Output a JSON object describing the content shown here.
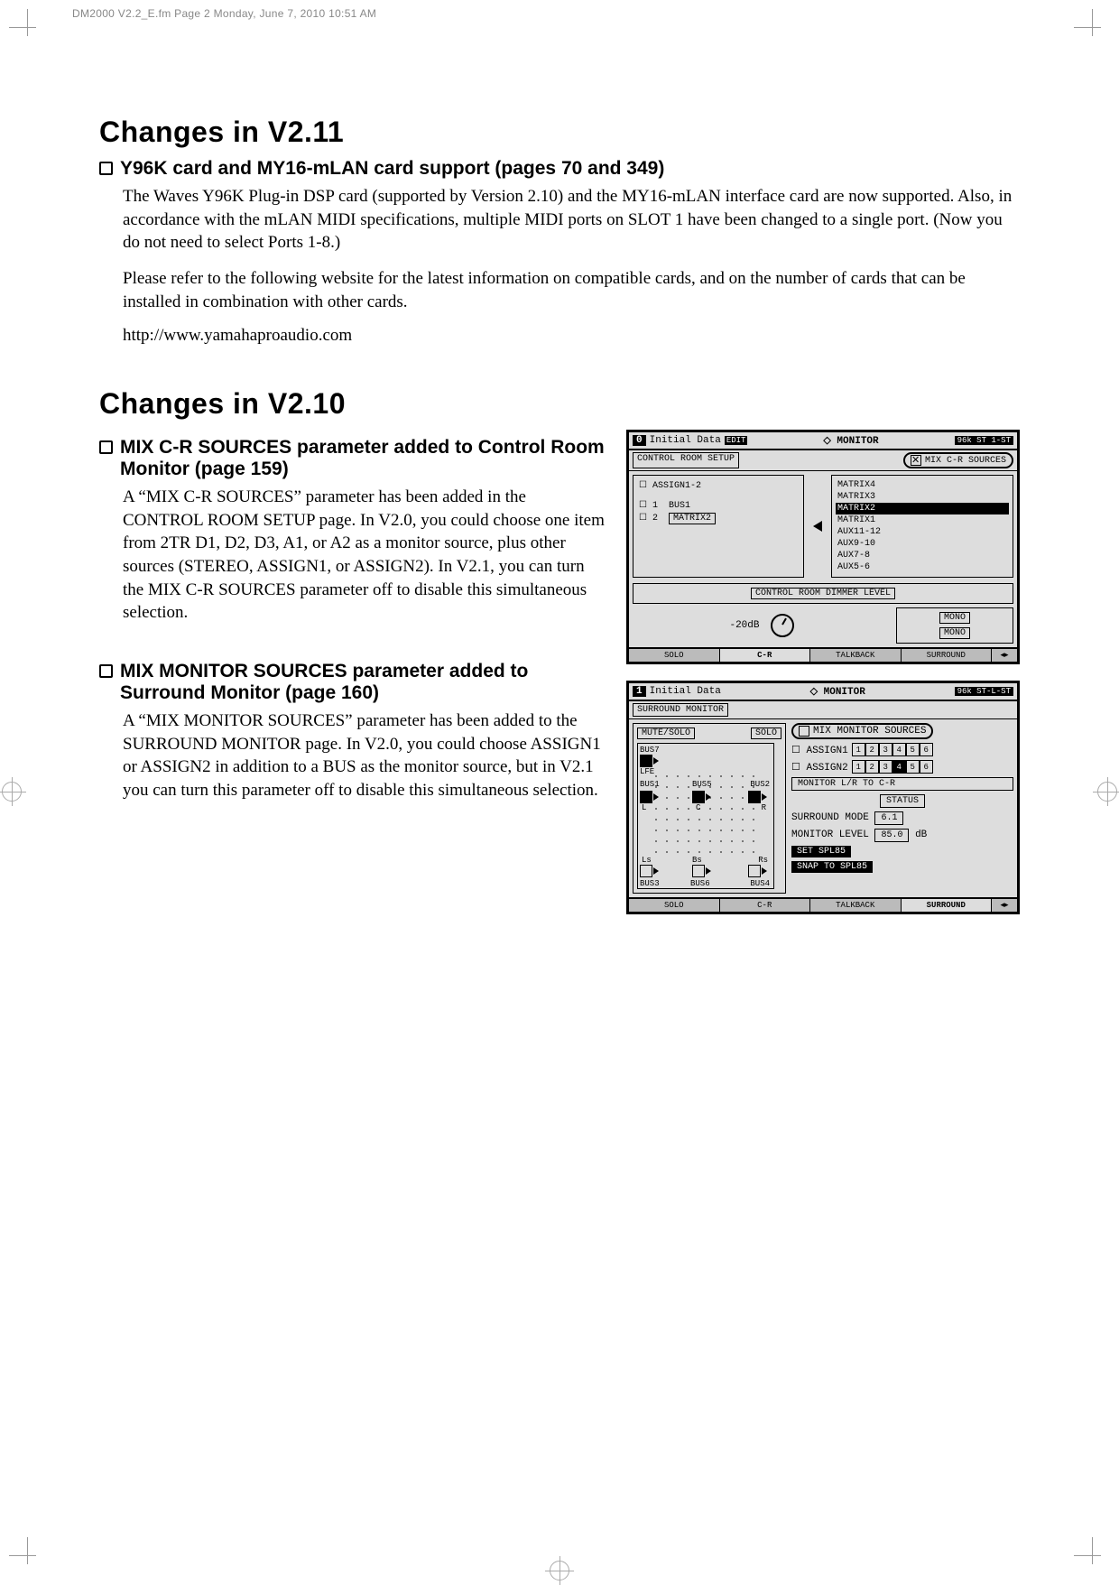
{
  "running_head": "DM2000 V2.2_E.fm  Page 2  Monday, June 7, 2010  10:51 AM",
  "h1_v211": "Changes in V2.11",
  "sec_y96k": {
    "title": "Y96K card and MY16-mLAN card support (pages 70 and 349)",
    "p1": "The Waves Y96K Plug-in DSP card (supported by Version 2.10) and the MY16-mLAN interface card are now supported. Also, in accordance with the mLAN MIDI specifications, multiple MIDI ports on SLOT 1 have been changed to a single port. (Now you do not need to select Ports 1-8.)",
    "p2": "Please refer to the following website for the latest information on compatible cards, and on the number of cards that can be installed in combination with other cards.",
    "url": "http://www.yamahaproaudio.com"
  },
  "h1_v210": "Changes in V2.10",
  "sec_mixcr": {
    "title": "MIX C-R SOURCES parameter added to Control Room Monitor (page 159)",
    "p1": "A “MIX C-R SOURCES” parameter has been added in the CONTROL ROOM SETUP page. In V2.0, you could choose one item from 2TR D1, D2, D3, A1, or A2 as a monitor source, plus other sources (STEREO, ASSIGN1, or ASSIGN2). In V2.1, you can turn the MIX C-R SOURCES parameter off to disable this simultaneous selection."
  },
  "sec_mixmon": {
    "title": "MIX MONITOR SOURCES parameter added to Surround Monitor (page 160)",
    "p1": "A “MIX MONITOR SOURCES” parameter has been added to the SURROUND MONITOR page. In V2.0, you could choose ASSIGN1 or ASSIGN2 in addition to a BUS as the monitor source, but in V2.1 you can turn this parameter off to disable this simultaneous selection."
  },
  "lcd1": {
    "title_num": "0",
    "title_name": "Initial Data",
    "title_edit": "EDIT",
    "monitor": "◇ MONITOR",
    "title_right": "96k ST 1-ST",
    "subhead_left": "CONTROL ROOM SETUP",
    "subhead_check_label": "MIX C-R SOURCES",
    "assign_label": "ASSIGN1-2",
    "row1_num": "1",
    "row1_label": "BUS1",
    "row2_num": "2",
    "row2_label": "MATRIX2",
    "list": [
      "MATRIX4",
      "MATRIX3",
      "MATRIX2",
      "MATRIX1",
      "AUX11-12",
      "AUX9-10",
      "AUX7-8",
      "AUX5-6"
    ],
    "list_sel_index": 2,
    "dimmer_label": "CONTROL ROOM DIMMER LEVEL",
    "dimmer_value": "-20dB",
    "mono_title": "MONO",
    "mono_btn": "MONO",
    "tabs": [
      "SOLO",
      "C-R",
      "TALKBACK",
      "SURROUND"
    ],
    "active_tab": 1
  },
  "lcd2": {
    "title_num": "1",
    "title_name": "Initial Data",
    "monitor": "◇ MONITOR",
    "title_right": "96k ST-L-ST",
    "subhead_left": "SURROUND MONITOR",
    "mute_solo": "MUTE/SOLO",
    "solo": "SOLO",
    "mix_src_label": "MIX MONITOR SOURCES",
    "assign2_label": "ASSIGN2",
    "monitor_lr_label": "MONITOR L/R TO C-R",
    "status_label": "STATUS",
    "surround_mode_label": "SURROUND MODE",
    "surround_mode_value": "6.1",
    "monitor_level_label": "MONITOR LEVEL",
    "monitor_level_value": "85.0",
    "monitor_level_unit": "dB",
    "set_spl": "SET SPL85",
    "snap_spl": "SNAP TO SPL85",
    "bus_labels": {
      "bus7": "BUS7",
      "lfe": "LFE",
      "bus1": "BUS1",
      "bus5": "BUS5",
      "bus2": "BUS2",
      "L": "L",
      "C": "C",
      "R": "R",
      "Ls": "Ls",
      "Bs": "Bs",
      "Rs": "Rs",
      "bus3": "BUS3",
      "bus6": "BUS6",
      "bus4": "BUS4"
    },
    "assign_nums": [
      "1",
      "2",
      "3",
      "4",
      "5",
      "6"
    ],
    "assign_sel_index": 3,
    "tabs": [
      "SOLO",
      "C-R",
      "TALKBACK",
      "SURROUND"
    ],
    "active_tab": 3
  }
}
